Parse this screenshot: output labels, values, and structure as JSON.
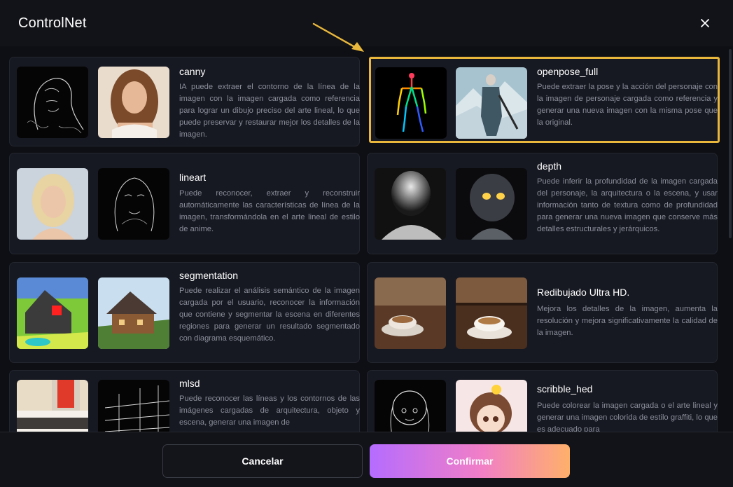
{
  "dialog": {
    "title": "ControlNet",
    "close_icon": "close-icon"
  },
  "items": [
    {
      "title": "canny",
      "desc": "IA puede extraer el contorno de la línea de la imagen con la imagen cargada como referencia para lograr un dibujo preciso del arte lineal, lo que puede preservar y restaurar mejor los detalles de la imagen.",
      "selected": false
    },
    {
      "title": "openpose_full",
      "desc": "Puede extraer la pose y la acción del personaje con la imagen de personaje cargada como referencia y generar una nueva imagen con la misma pose que la original.",
      "selected": true
    },
    {
      "title": "lineart",
      "desc": "Puede reconocer, extraer y reconstruir automáticamente las características de línea de la imagen, transformándola en el arte lineal de estilo de anime.",
      "selected": false
    },
    {
      "title": "depth",
      "desc": "Puede inferir la profundidad de la imagen cargada del personaje, la arquitectura o la escena, y usar información tanto de textura como de profundidad para generar una nueva imagen que conserve más detalles estructurales y jerárquicos.",
      "selected": false
    },
    {
      "title": "segmentation",
      "desc": "Puede realizar el análisis semántico de la imagen cargada por el usuario, reconocer la información que contiene y segmentar la escena en diferentes regiones para generar un resultado segmentado con diagrama esquemático.",
      "selected": false
    },
    {
      "title": "Redibujado Ultra HD.",
      "desc": "Mejora los detalles de la imagen, aumenta la resolución y mejora significativamente la calidad de la imagen.",
      "selected": false
    },
    {
      "title": "mlsd",
      "desc": "Puede reconocer las líneas y los contornos de las imágenes cargadas de arquitectura, objeto y escena, generar una imagen de",
      "selected": false
    },
    {
      "title": "scribble_hed",
      "desc": "Puede colorear la imagen cargada o el arte lineal y generar una imagen colorida de estilo graffiti, lo que es adecuado para",
      "selected": false
    }
  ],
  "footer": {
    "cancel_label": "Cancelar",
    "confirm_label": "Confirmar"
  },
  "colors": {
    "selected_border": "#e9b73c",
    "confirm_gradient_start": "#b56cff",
    "confirm_gradient_end": "#ffb06a"
  }
}
